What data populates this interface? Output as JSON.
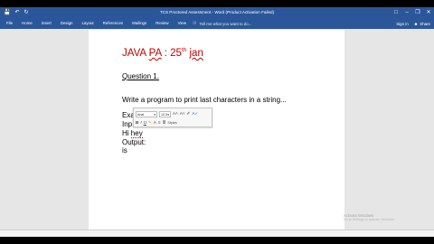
{
  "window": {
    "title": "TCS Proctored Assessment - Word (Product Activation Failed)"
  },
  "quick_access": {
    "save_icon": "save-icon",
    "undo_icon": "undo-icon",
    "redo_icon": "redo-icon"
  },
  "ribbon": {
    "tabs": [
      "File",
      "Home",
      "Insert",
      "Design",
      "Layout",
      "References",
      "Mailings",
      "Review",
      "View"
    ],
    "tell_me_placeholder": "Tell me what you want to do...",
    "sign_in": "Sign in",
    "share": "Share"
  },
  "document": {
    "heading_prefix": "JAVA ",
    "heading_pa": "PA",
    "heading_mid": " : 25",
    "heading_sup": "th",
    "heading_month": "jan",
    "question": "Question 1.",
    "prompt": "Write a program to print last characters in a string...",
    "lines": [
      "Exa",
      "Inp",
      "Hi",
      "Output:",
      "is"
    ],
    "line3_selected": "hey"
  },
  "mini_toolbar": {
    "font_name": "Arial",
    "font_size": "10.5",
    "styles_label": "Styles"
  },
  "watermark": {
    "title": "Activate Windows",
    "subtitle": "Go to Settings to activate Windows."
  },
  "colors": {
    "ribbon_blue": "#2b579a",
    "heading_red": "#c00000"
  }
}
